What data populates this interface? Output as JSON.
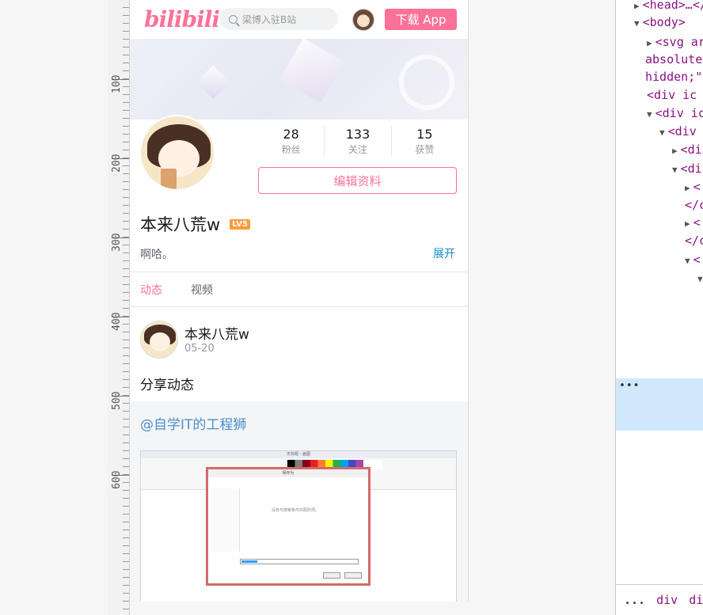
{
  "ruler": {
    "marks": [
      "100",
      "200",
      "300",
      "400",
      "500",
      "600"
    ]
  },
  "header": {
    "logo": "bilibili",
    "search_placeholder": "梁博入驻B站",
    "download_label": "下载 App"
  },
  "profile": {
    "stats": [
      {
        "value": "28",
        "label": "粉丝"
      },
      {
        "value": "133",
        "label": "关注"
      },
      {
        "value": "15",
        "label": "获赞"
      }
    ],
    "edit_label": "编辑资料",
    "username": "本来八荒w",
    "level_badge": "LV5",
    "signature": "啊哈。",
    "expand_label": "展开"
  },
  "tabs": [
    {
      "label": "动态",
      "active": true
    },
    {
      "label": "视频",
      "active": false
    }
  ],
  "post": {
    "author": "本来八荒w",
    "date": "05-20",
    "text": "分享动态",
    "forward_mention": "@自学IT的工程狮",
    "screenshot_title": "无标题 - 画图",
    "screenshot_dialog_title": "保存为",
    "screenshot_message": "没有与搜索条件匹配的项。"
  },
  "devtools": {
    "lines": [
      {
        "indent": 0,
        "tri": "▶",
        "text": "<head>…</"
      },
      {
        "indent": 0,
        "tri": "▼",
        "text": "<body>"
      },
      {
        "indent": 1,
        "tri": "▶",
        "text": "<svg ar"
      },
      {
        "indent": 0,
        "tri": "",
        "text": "absolute"
      },
      {
        "indent": 0,
        "tri": "",
        "text": "hidden;\""
      },
      {
        "indent": 1,
        "tri": "",
        "text": "<div ic"
      },
      {
        "indent": 1,
        "tri": "▼",
        "text": "<div ic"
      },
      {
        "indent": 2,
        "tri": "▼",
        "text": "<div"
      },
      {
        "indent": 3,
        "tri": "▶",
        "text": "<di"
      },
      {
        "indent": 3,
        "tri": "▼",
        "text": "<di"
      },
      {
        "indent": 4,
        "tri": "▶",
        "text": "<"
      },
      {
        "indent": 4,
        "tri": "",
        "text": "</c"
      },
      {
        "indent": 4,
        "tri": "▶",
        "text": "<"
      },
      {
        "indent": 4,
        "tri": "",
        "text": "</c"
      },
      {
        "indent": 4,
        "tri": "▼",
        "text": "<"
      },
      {
        "indent": 5,
        "tri": "▼",
        "text": ""
      }
    ],
    "selected_marker": "•••",
    "breadcrumbs": [
      "...",
      "div",
      "div"
    ]
  },
  "colors": {
    "brand": "#fb7299",
    "link": "#178bcf",
    "mention": "#4a8fca"
  }
}
